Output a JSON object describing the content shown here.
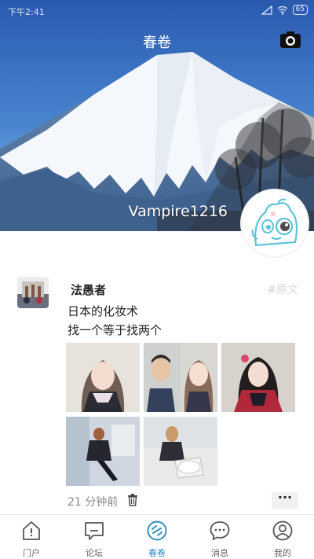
{
  "status_bar": {
    "time": "下午2:41",
    "battery": "65"
  },
  "header": {
    "title": "春卷",
    "username": "Vampire1216"
  },
  "post": {
    "author": "法愚者",
    "tag": "#原文",
    "lines": [
      "日本的化妆术",
      "找一个等于找两个"
    ],
    "time": "21 分钟前",
    "more_label": "···"
  },
  "tabs": [
    {
      "label": "门户",
      "icon": "portal-icon",
      "active": false
    },
    {
      "label": "论坛",
      "icon": "forum-icon",
      "active": false
    },
    {
      "label": "春卷",
      "icon": "chunjuan-icon",
      "active": true
    },
    {
      "label": "消息",
      "icon": "message-icon",
      "active": false
    },
    {
      "label": "我的",
      "icon": "profile-icon",
      "active": false
    }
  ],
  "colors": {
    "accent": "#2b8cc4",
    "sky": "#2f63b4"
  }
}
